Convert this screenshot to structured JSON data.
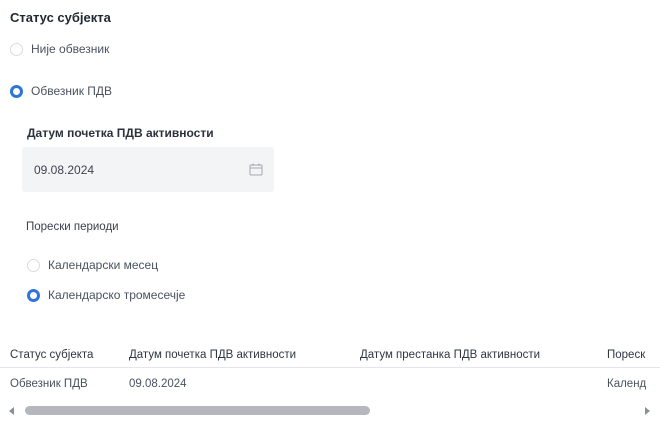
{
  "section_title": "Статус субјекта",
  "status_options": [
    {
      "label": "Није обвезник",
      "checked": false
    },
    {
      "label": "Обвезник ПДВ",
      "checked": true
    }
  ],
  "start_date": {
    "label": "Датум почетка ПДВ активности",
    "value": "09.08.2024",
    "icon": "calendar-icon"
  },
  "tax_periods": {
    "label": "Порески периоди",
    "options": [
      {
        "label": "Календарски месец",
        "checked": false
      },
      {
        "label": "Календарско тромесечје",
        "checked": true
      }
    ]
  },
  "table": {
    "headers": [
      "Статус субјекта",
      "Датум почетка ПДВ активности",
      "Датум престанка ПДВ активности",
      "Пореск"
    ],
    "rows": [
      [
        "Обвезник ПДВ",
        "09.08.2024",
        "",
        "Календ"
      ]
    ]
  },
  "colors": {
    "accent": "#2f74d8",
    "input_bg": "#f3f4f6",
    "scrollbar": "#b4b8be"
  }
}
